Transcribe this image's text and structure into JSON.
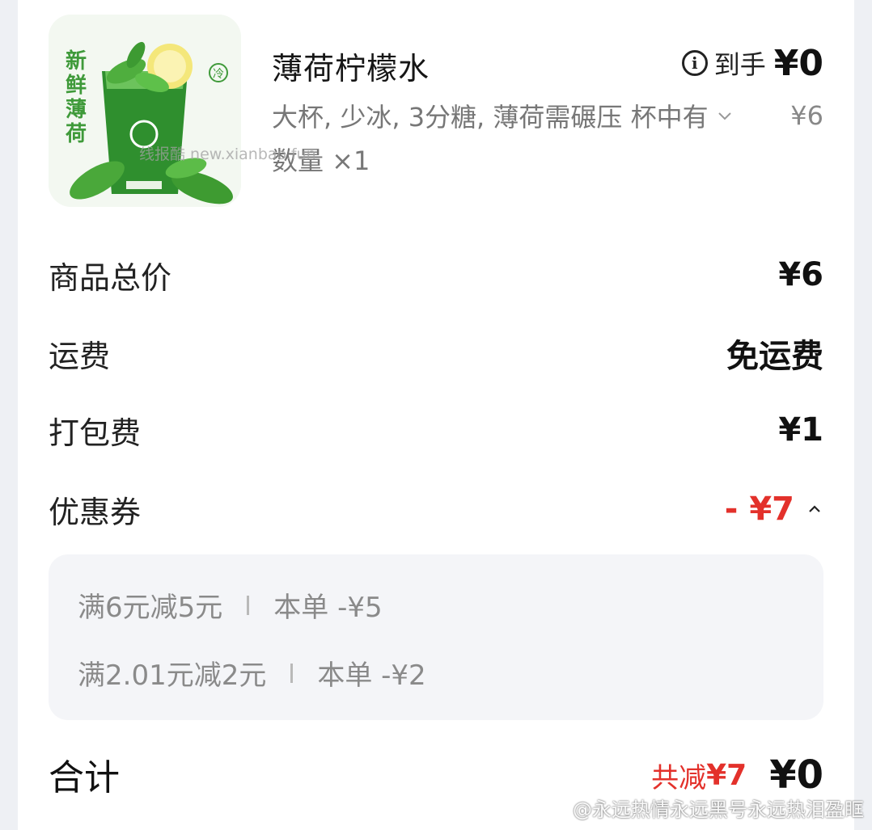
{
  "product": {
    "image_text_vertical": "新鲜薄荷",
    "image_badge": "冷",
    "title": "薄荷柠檬水",
    "arrive_label": "到手",
    "arrive_price": "¥0",
    "specs": "大杯, 少冰, 3分糖, 薄荷需碾压 杯中有",
    "spec_price": "¥6",
    "quantity": "数量 ×1"
  },
  "watermarks": {
    "middle": "线报酷 new.xianbao.fun",
    "weibo": "@永远热情永远黑号永远热泪盈眶"
  },
  "fees": [
    {
      "label": "商品总价",
      "value": "¥6"
    },
    {
      "label": "运费",
      "value": "免运费"
    },
    {
      "label": "打包费",
      "value": "¥1"
    }
  ],
  "coupon": {
    "label": "优惠券",
    "value": "- ¥7",
    "items": [
      {
        "rule": "满6元减5元",
        "amount": "本单 -¥5"
      },
      {
        "rule": "满2.01元减2元",
        "amount": "本单 -¥2"
      }
    ]
  },
  "total": {
    "label": "合计",
    "saved_label": "共减",
    "saved_amount": "¥7",
    "amount": "¥0"
  },
  "colors": {
    "accent_red": "#e3312b",
    "text_primary": "#111111",
    "text_secondary": "#777777",
    "coupon_bg": "#f4f5f8",
    "mint_green": "#3f9a3a"
  },
  "icons": [
    "info-icon",
    "chevron-down-icon",
    "chevron-up-icon",
    "weibo-icon"
  ]
}
